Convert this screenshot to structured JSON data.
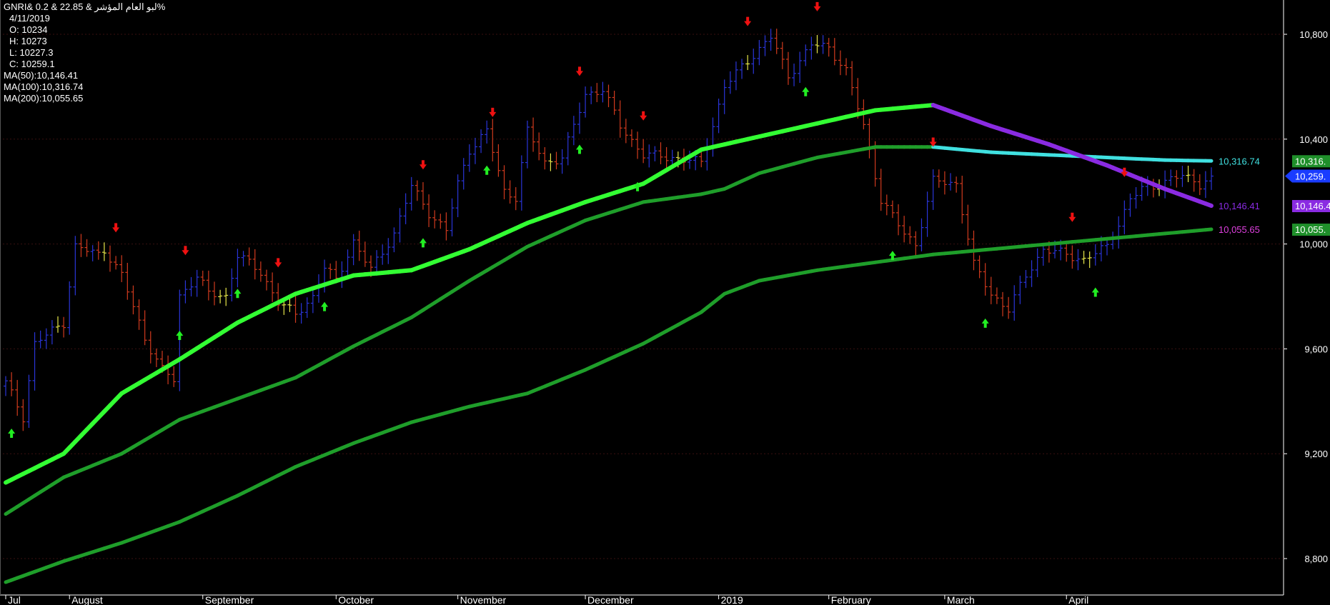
{
  "header": {
    "symbol_line": "GNRI& لبو العام المؤشر &  22.85 & 0.2%",
    "date": "4/11/2019",
    "open": "O: 10234",
    "high": "H: 10273",
    "low": "L: 10227.3",
    "close": "C: 10259.1",
    "ma50": "MA(50):10,146.41",
    "ma100": "MA(100):10,316.74",
    "ma200": "MA(200):10,055.65"
  },
  "colors": {
    "background": "#000000",
    "up_bar": "#2a35d8",
    "down_bar": "#d03a1e",
    "flat_bar": "#e6e64a",
    "ma50_rising": "#33ff33",
    "ma50_falling": "#8a2be2",
    "ma100_rising": "#1f9e2a",
    "ma100_falling": "#40e0e0",
    "ma200": "#1f9e2a",
    "up_signal": "#22ee22",
    "down_signal": "#ee1111",
    "grid": "#3a1010"
  },
  "chart_data": {
    "type": "line",
    "title": "GNRI& لبو العام المؤشر",
    "ylim": [
      8700,
      11000
    ],
    "y_ticks": [
      "10,800",
      "10,400",
      "10,000",
      "9,600",
      "9,200",
      "8,800"
    ],
    "x_ticks": [
      "Jul",
      "August",
      "September",
      "October",
      "November",
      "December",
      "2019",
      "February",
      "March",
      "April"
    ],
    "price_anchors": {
      "x": [
        0,
        3,
        5,
        10,
        12,
        16,
        17,
        20,
        24,
        27,
        29,
        30,
        33,
        35,
        38,
        40,
        44,
        47,
        50,
        53,
        55,
        57,
        60,
        63,
        67,
        70,
        73,
        76,
        78,
        80,
        83,
        86,
        88,
        90,
        93,
        96,
        100,
        103,
        106,
        110,
        115,
        120,
        124,
        128,
        132,
        135,
        139,
        142,
        145,
        148,
        151,
        155,
        157,
        160,
        164,
        167,
        170,
        173,
        176,
        179,
        183,
        186,
        190,
        194,
        196,
        198,
        200,
        203,
        206,
        208
      ],
      "y": [
        9470,
        9340,
        9620,
        9700,
        9990,
        9960,
        9980,
        9880,
        9640,
        9520,
        9480,
        9800,
        9880,
        9810,
        9800,
        9960,
        9890,
        9780,
        9730,
        9800,
        9910,
        9860,
        10010,
        9900,
        10040,
        10220,
        10120,
        10050,
        10230,
        10360,
        10430,
        10200,
        10180,
        10430,
        10310,
        10330,
        10570,
        10590,
        10450,
        10340,
        10330,
        10310,
        10600,
        10700,
        10790,
        10640,
        10760,
        10750,
        10660,
        10450,
        10170,
        10040,
        10000,
        10240,
        10230,
        9920,
        9810,
        9750,
        9880,
        9980,
        9960,
        9940,
        9990,
        10170,
        10210,
        10220,
        10240,
        10260,
        10230,
        10259
      ]
    },
    "ma_anchors": {
      "x": [
        0,
        10,
        20,
        30,
        40,
        50,
        60,
        70,
        80,
        90,
        100,
        110,
        120,
        124,
        130,
        140,
        150,
        160,
        170,
        180,
        190,
        200,
        208
      ],
      "ma50": [
        9090,
        9200,
        9430,
        9560,
        9700,
        9810,
        9880,
        9900,
        9980,
        10080,
        10160,
        10230,
        10360,
        10380,
        10410,
        10460,
        10510,
        10530,
        10450,
        10380,
        10300,
        10210,
        10146
      ],
      "ma100": [
        8970,
        9110,
        9200,
        9330,
        9410,
        9490,
        9610,
        9720,
        9860,
        9990,
        10090,
        10160,
        10190,
        10210,
        10270,
        10330,
        10370,
        10370,
        10350,
        10340,
        10330,
        10320,
        10317
      ],
      "ma200": [
        8710,
        8790,
        8860,
        8940,
        9040,
        9150,
        9240,
        9320,
        9380,
        9430,
        9520,
        9620,
        9740,
        9810,
        9860,
        9900,
        9930,
        9960,
        9980,
        10000,
        10020,
        10040,
        10056
      ]
    },
    "up_signals": [
      1,
      30,
      40,
      55,
      72,
      83,
      99,
      109,
      138,
      153,
      169,
      188
    ],
    "down_signals": [
      19,
      31,
      47,
      72,
      84,
      99,
      110,
      128,
      140,
      160,
      184,
      193
    ],
    "series": [
      {
        "name": "MA(50)",
        "last_label": "10,146.41",
        "box_label": "10,146.4"
      },
      {
        "name": "MA(100)",
        "last_label": "10,316.74",
        "box_label": "10,316."
      },
      {
        "name": "MA(200)",
        "last_label": "10,055.65",
        "box_label": "10,055."
      }
    ],
    "last_price_label": "10,259."
  }
}
